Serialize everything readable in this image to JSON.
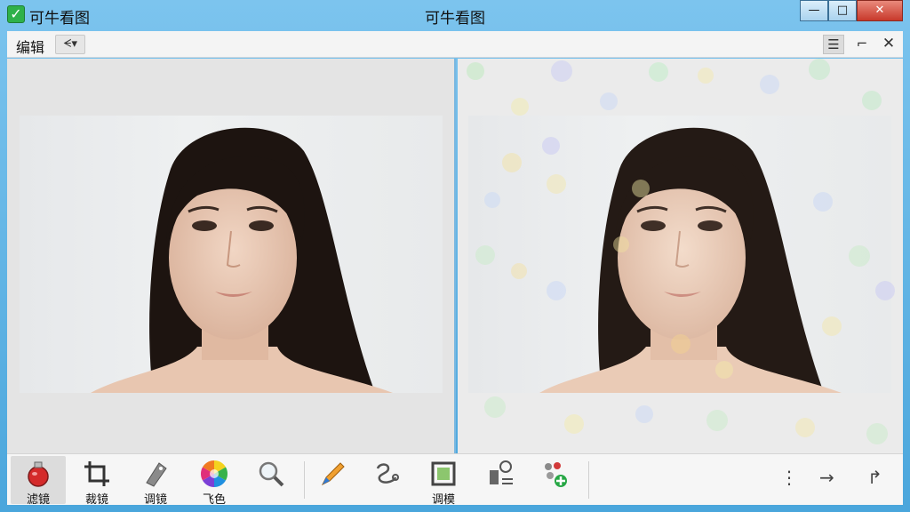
{
  "app": {
    "name": "可牛看图",
    "window_title": "可牛看图"
  },
  "title_buttons": {
    "minimize": "—",
    "maximize": "□",
    "close": "✕"
  },
  "menubar": {
    "edit_label": "编辑",
    "edit_dropdown": "ᗕ▾",
    "right_list": "☰",
    "right_minimize": "⌐",
    "right_close": "✕"
  },
  "toolbar": {
    "tools": [
      {
        "label": "滤镜",
        "icon": "filter-flask-icon",
        "active": true
      },
      {
        "label": "裁镜",
        "icon": "crop-icon",
        "active": false
      },
      {
        "label": "调镜",
        "icon": "adjust-tag-icon",
        "active": false
      },
      {
        "label": "飞色",
        "icon": "color-wheel-icon",
        "active": false
      },
      {
        "label": "",
        "icon": "magnifier-icon",
        "active": false
      },
      {
        "label": "",
        "icon": "pencil-icon",
        "active": false
      },
      {
        "label": "",
        "icon": "brush-stroke-icon",
        "active": false
      },
      {
        "label": "调模",
        "icon": "frame-icon",
        "active": false
      },
      {
        "label": "",
        "icon": "stamp-text-icon",
        "active": false
      },
      {
        "label": "",
        "icon": "effects-add-icon",
        "active": false
      }
    ],
    "right": {
      "more": "⋮",
      "next": "→",
      "redo": "↱"
    }
  },
  "colors": {
    "title_bar": "#7cc4ee",
    "close_button": "#c8392b",
    "app_icon": "#2fb14a"
  }
}
